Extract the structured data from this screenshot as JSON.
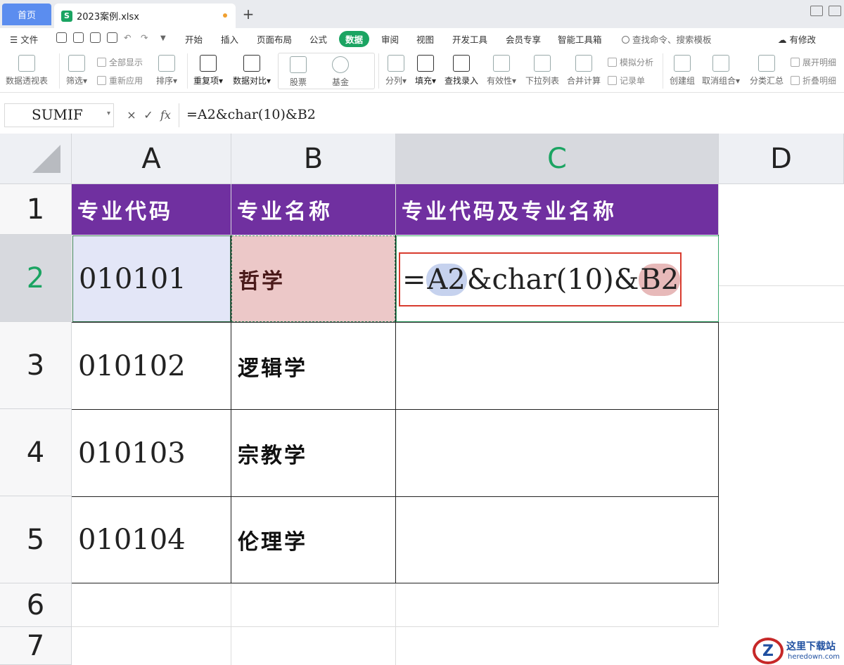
{
  "tabs": {
    "home": "首页",
    "file": "2023案例.xlsx",
    "file_icon": "S"
  },
  "menu": {
    "file": "文件",
    "items": [
      "开始",
      "插入",
      "页面布局",
      "公式",
      "数据",
      "审阅",
      "视图",
      "开发工具",
      "会员专享",
      "智能工具箱"
    ],
    "active": "数据",
    "search_placeholder": "查找命令、搜索模板",
    "modify": "有修改"
  },
  "ribbon": {
    "pivot": "数据透视表",
    "filter": "筛选",
    "show_all": "全部显示",
    "reapply": "重新应用",
    "sort": "排序",
    "duplicates": "重复项",
    "compare": "数据对比",
    "stock": "股票",
    "fund": "基金",
    "split": "分列",
    "fill": "填充",
    "lookup": "查找录入",
    "validity": "有效性",
    "dropdown": "下拉列表",
    "merge_calc": "合并计算",
    "simulate": "模拟分析",
    "record": "记录单",
    "create_group": "创建组",
    "ungroup": "取消组合",
    "subtotal": "分类汇总",
    "expand": "展开明细",
    "collapse": "折叠明细"
  },
  "formula_bar": {
    "name_box": "SUMIF",
    "cancel": "×",
    "confirm": "✓",
    "fx": "fx",
    "formula": "=A2&char(10)&B2"
  },
  "columns": [
    "A",
    "B",
    "C",
    "D"
  ],
  "rows": [
    "1",
    "2",
    "3",
    "4",
    "5",
    "6",
    "7"
  ],
  "headers": {
    "A": "专业代码",
    "B": "专业名称",
    "C": "专业代码及专业名称"
  },
  "records": [
    {
      "code": "010101",
      "name": "哲学"
    },
    {
      "code": "010102",
      "name": "逻辑学"
    },
    {
      "code": "010103",
      "name": "宗教学"
    },
    {
      "code": "010104",
      "name": "伦理学"
    }
  ],
  "edit_formula": {
    "prefix": "=",
    "ref_a": "A2",
    "middle": "&char(10)&",
    "ref_b": "B2"
  },
  "watermark": {
    "logo": "Z",
    "title": "这里下载站",
    "site": "heredown.com"
  }
}
